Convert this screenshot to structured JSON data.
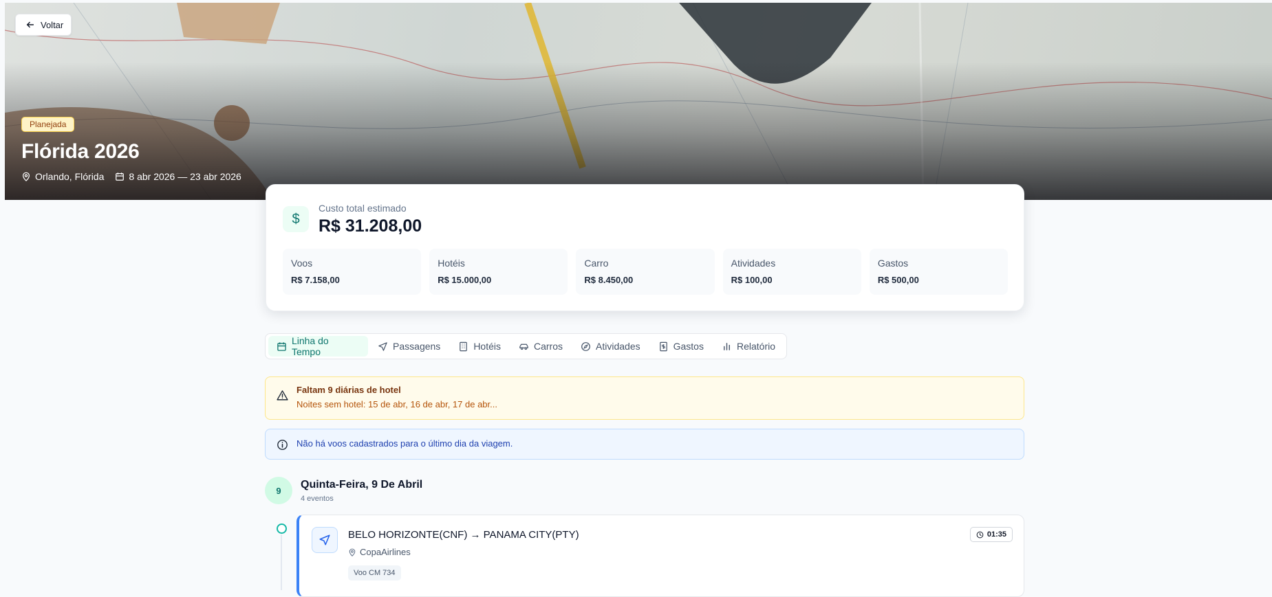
{
  "header": {
    "back_label": "Voltar",
    "status": "Planejada",
    "title": "Flórida 2026",
    "location": "Orlando, Flórida",
    "dates": "8 abr 2026 — 23 abr 2026"
  },
  "costs": {
    "label": "Custo total estimado",
    "total": "R$ 31.208,00",
    "icon": "$",
    "items": [
      {
        "label": "Voos",
        "value": "R$ 7.158,00"
      },
      {
        "label": "Hotéis",
        "value": "R$ 15.000,00"
      },
      {
        "label": "Carro",
        "value": "R$ 8.450,00"
      },
      {
        "label": "Atividades",
        "value": "R$ 100,00"
      },
      {
        "label": "Gastos",
        "value": "R$ 500,00"
      }
    ]
  },
  "tabs": [
    {
      "label": "Linha do Tempo",
      "icon": "calendar-icon",
      "active": true
    },
    {
      "label": "Passagens",
      "icon": "plane-icon"
    },
    {
      "label": "Hotéis",
      "icon": "building-icon"
    },
    {
      "label": "Carros",
      "icon": "car-icon"
    },
    {
      "label": "Atividades",
      "icon": "compass-icon"
    },
    {
      "label": "Gastos",
      "icon": "receipt-icon"
    },
    {
      "label": "Relatório",
      "icon": "bar-chart-icon"
    }
  ],
  "alerts": {
    "warning_title": "Faltam 9 diárias de hotel",
    "warning_detail": "Noites sem hotel: 15 de abr, 16 de abr, 17 de abr...",
    "info_text": "Não há voos cadastrados para o último dia da viagem."
  },
  "day": {
    "number": "9",
    "title": "Quinta-Feira, 9 De Abril",
    "count": "4 eventos"
  },
  "event": {
    "title": "BELO HORIZONTE(CNF) → PANAMA CITY(PTY)",
    "airline": "CopaAirlines",
    "flight": "Voo CM 734",
    "duration": "01:35"
  },
  "colors": {
    "accent": "#0f766e",
    "warning": "#fffbeb",
    "info": "#eff6ff",
    "flight_border": "#3b82f6"
  }
}
